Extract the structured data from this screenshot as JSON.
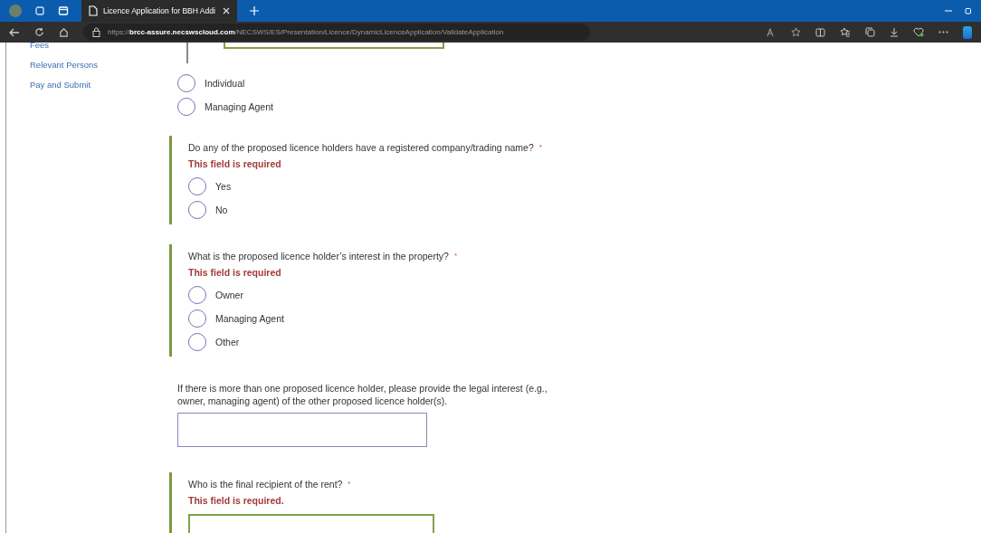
{
  "browser": {
    "tab": {
      "title": "Licence Application for BBH Addi",
      "selected": true
    },
    "address": "https://**brcc-assure.necswscloud.com**/NECSWS/ES/Presentation/Licence/DynamicLicenceApplication/ValidateApplication"
  },
  "sidebar": {
    "items": [
      {
        "label": "Fees"
      },
      {
        "label": "Relevant Persons"
      },
      {
        "label": "Pay and Submit"
      }
    ]
  },
  "form": {
    "top_options": [
      {
        "label": "Individual",
        "selected": false
      },
      {
        "label": "Managing Agent",
        "selected": false
      }
    ],
    "questions": [
      {
        "kind": "radio",
        "label": "Do any of the proposed licence holders have a registered company/trading name?",
        "required": true,
        "required_mark": "*",
        "error": "This field is required",
        "options": [
          {
            "label": "Yes",
            "selected": false
          },
          {
            "label": "No",
            "selected": false
          }
        ]
      },
      {
        "kind": "radio",
        "label": "What is the proposed licence holder’s interest in the property?",
        "required": true,
        "required_mark": "*",
        "error": "This field is required",
        "options": [
          {
            "label": "Owner",
            "selected": false
          },
          {
            "label": "Managing Agent",
            "selected": false
          },
          {
            "label": "Other",
            "selected": false
          }
        ]
      },
      {
        "kind": "text",
        "label": "If there is more than one proposed licence holder, please provide the legal interest (e.g., owner, managing agent) of the other proposed licence holder(s).",
        "required": false
      },
      {
        "kind": "text",
        "label": "Who is the final recipient of the rent?",
        "required": true,
        "required_mark": "*",
        "error": "This field is required."
      }
    ]
  }
}
